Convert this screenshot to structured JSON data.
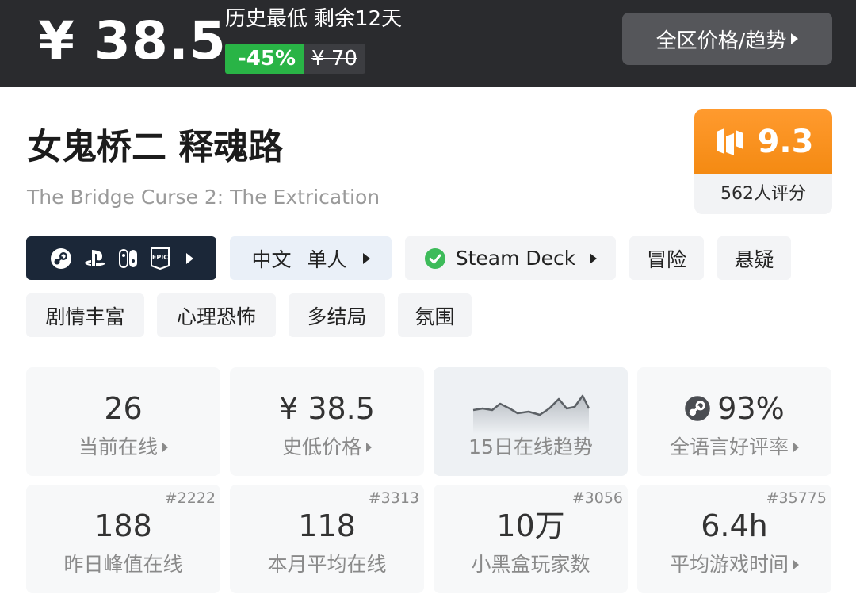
{
  "price_bar": {
    "current_price": "¥ 38.5",
    "note_low": "历史最低",
    "note_remaining": "剩余12天",
    "discount": "-45%",
    "original_price": "¥ 70",
    "region_button": "全区价格/趋势",
    "colors": {
      "bar_bg": "#2a2b2e",
      "discount_bg": "#29b446"
    }
  },
  "game": {
    "title": "女鬼桥二 释魂路",
    "subtitle": "The Bridge Curse 2: The Extrication"
  },
  "score": {
    "value": "9.3",
    "ratings": "562人评分",
    "icon": "heybox-logo-icon",
    "color": "#f48a12"
  },
  "tags": {
    "platforms": [
      "steam-icon",
      "playstation-icon",
      "switch-icon",
      "epic-icon"
    ],
    "language": "中文",
    "players": "单人",
    "deck": "Steam Deck",
    "genres": [
      "冒险",
      "悬疑",
      "剧情丰富",
      "心理恐怖",
      "多结局",
      "氛围"
    ]
  },
  "stats": {
    "online_now": {
      "value": "26",
      "label": "当前在线"
    },
    "lowest_price": {
      "value": "¥ 38.5",
      "label": "史低价格"
    },
    "trend": {
      "label": "15日在线趋势"
    },
    "positive_rate": {
      "value": "93%",
      "label": "全语言好评率"
    },
    "peak_yesterday": {
      "value": "188",
      "label": "昨日峰值在线",
      "rank": "#2222"
    },
    "monthly_avg": {
      "value": "118",
      "label": "本月平均在线",
      "rank": "#3313"
    },
    "players": {
      "value": "10万",
      "label": "小黑盒玩家数",
      "rank": "#3056"
    },
    "avg_playtime": {
      "value": "6.4h",
      "label": "平均游戏时间",
      "rank": "#35775"
    }
  }
}
